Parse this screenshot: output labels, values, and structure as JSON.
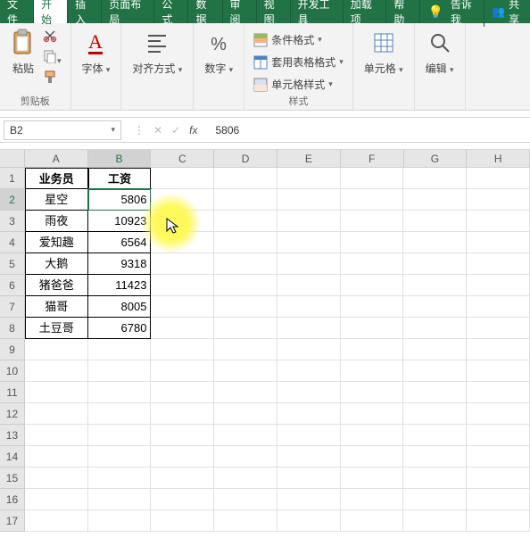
{
  "tabs": {
    "file": "文件",
    "home": "开始",
    "insert": "插入",
    "layout": "页面布局",
    "formula": "公式",
    "data": "数据",
    "review": "审阅",
    "view": "视图",
    "dev": "开发工具",
    "addin": "加载项",
    "help": "帮助"
  },
  "tellme": "告诉我",
  "share": "共享",
  "ribbon": {
    "clipboard": {
      "paste": "粘贴",
      "label": "剪贴板"
    },
    "font": {
      "btn": "字体"
    },
    "align": {
      "btn": "对齐方式"
    },
    "number": {
      "btn": "数字"
    },
    "styles": {
      "cond": "条件格式",
      "table": "套用表格格式",
      "cell": "单元格样式",
      "label": "样式"
    },
    "cells": {
      "btn": "单元格"
    },
    "editing": {
      "btn": "编辑"
    }
  },
  "namebox": "B2",
  "formula_value": "5806",
  "columns": [
    "A",
    "B",
    "C",
    "D",
    "E",
    "F",
    "G",
    "H"
  ],
  "rows": [
    1,
    2,
    3,
    4,
    5,
    6,
    7,
    8,
    9,
    10,
    11,
    12,
    13,
    14,
    15,
    16,
    17
  ],
  "table": {
    "headers": {
      "a": "业务员",
      "b": "工资"
    },
    "data": [
      {
        "a": "星空",
        "b": "5806"
      },
      {
        "a": "雨夜",
        "b": "10923"
      },
      {
        "a": "爱知趣",
        "b": "6564"
      },
      {
        "a": "大鹅",
        "b": "9318"
      },
      {
        "a": "猪爸爸",
        "b": "11423"
      },
      {
        "a": "猫哥",
        "b": "8005"
      },
      {
        "a": "土豆哥",
        "b": "6780"
      }
    ]
  },
  "chart_data": {
    "type": "table",
    "title": "",
    "columns": [
      "业务员",
      "工资"
    ],
    "rows": [
      [
        "星空",
        5806
      ],
      [
        "雨夜",
        10923
      ],
      [
        "爱知趣",
        6564
      ],
      [
        "大鹅",
        9318
      ],
      [
        "猪爸爸",
        11423
      ],
      [
        "猫哥",
        8005
      ],
      [
        "土豆哥",
        6780
      ]
    ]
  }
}
